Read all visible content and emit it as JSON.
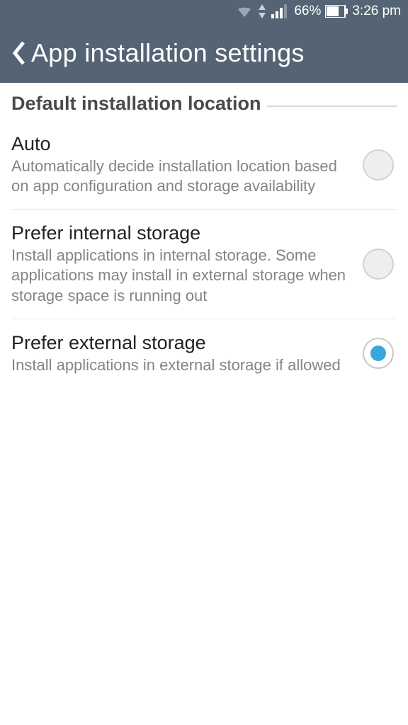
{
  "status_bar": {
    "battery_pct": "66%",
    "time": "3:26 pm"
  },
  "header": {
    "title": "App installation settings"
  },
  "section": {
    "title": "Default installation location"
  },
  "options": [
    {
      "title": "Auto",
      "desc": "Automatically decide installation location based on app configuration and storage availability",
      "selected": false
    },
    {
      "title": "Prefer internal storage",
      "desc": "Install applications in internal storage. Some applications may install in external storage when storage space is running out",
      "selected": false
    },
    {
      "title": "Prefer external storage",
      "desc": "Install applications in external storage if allowed",
      "selected": true
    }
  ]
}
